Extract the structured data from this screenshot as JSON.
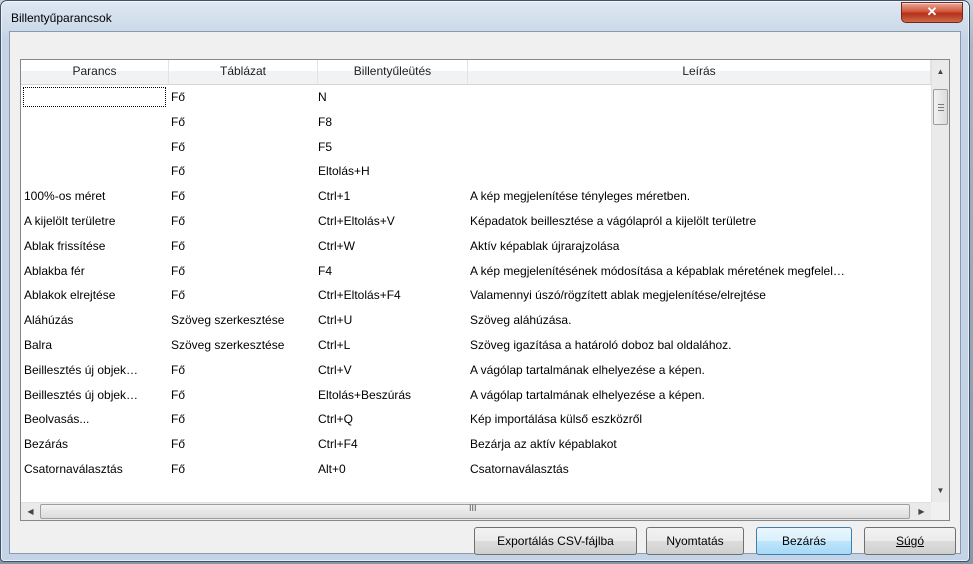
{
  "window": {
    "title": "Billentyűparancsok",
    "close_glyph": "✕"
  },
  "columns": [
    "Parancs",
    "Táblázat",
    "Billentyűleütés",
    "Leírás"
  ],
  "rows": [
    [
      "",
      "Fő",
      "N",
      ""
    ],
    [
      "",
      "Fő",
      "F8",
      ""
    ],
    [
      "",
      "Fő",
      "F5",
      ""
    ],
    [
      "",
      "Fő",
      "Eltolás+H",
      ""
    ],
    [
      "100%-os méret",
      "Fő",
      "Ctrl+1",
      "A kép megjelenítése tényleges méretben."
    ],
    [
      "A kijelölt területre",
      "Fő",
      "Ctrl+Eltolás+V",
      "Képadatok beillesztése a vágólapról a kijelölt területre"
    ],
    [
      "Ablak frissítése",
      "Fő",
      "Ctrl+W",
      "Aktív képablak újrarajzolása"
    ],
    [
      "Ablakba fér",
      "Fő",
      "F4",
      "A kép megjelenítésének módosítása a képablak méretének megfelel…"
    ],
    [
      "Ablakok elrejtése",
      "Fő",
      "Ctrl+Eltolás+F4",
      "Valamennyi úszó/rögzített ablak megjelenítése/elrejtése"
    ],
    [
      "Aláhúzás",
      "Szöveg szerkesztése",
      "Ctrl+U",
      "Szöveg aláhúzása."
    ],
    [
      "Balra",
      "Szöveg szerkesztése",
      "Ctrl+L",
      "Szöveg igazítása a határoló doboz bal oldalához."
    ],
    [
      "Beillesztés új objek…",
      "Fő",
      "Ctrl+V",
      "A vágólap tartalmának elhelyezése a képen."
    ],
    [
      "Beillesztés új objek…",
      "Fő",
      "Eltolás+Beszúrás",
      "A vágólap tartalmának elhelyezése a képen."
    ],
    [
      "Beolvasás...",
      "Fő",
      "Ctrl+Q",
      "Kép importálása külső eszközről"
    ],
    [
      "Bezárás",
      "Fő",
      "Ctrl+F4",
      "Bezárja az aktív képablakot"
    ],
    [
      "Csatornaválasztás",
      "Fő",
      "Alt+0",
      "Csatornaválasztás"
    ]
  ],
  "scroll": {
    "up": "▲",
    "down": "▼",
    "left": "◀",
    "right": "▶",
    "h_grip": "III"
  },
  "buttons": {
    "export": "Exportálás CSV-fájlba",
    "print": "Nyomtatás",
    "close": "Bezárás",
    "help": "Súgó"
  }
}
